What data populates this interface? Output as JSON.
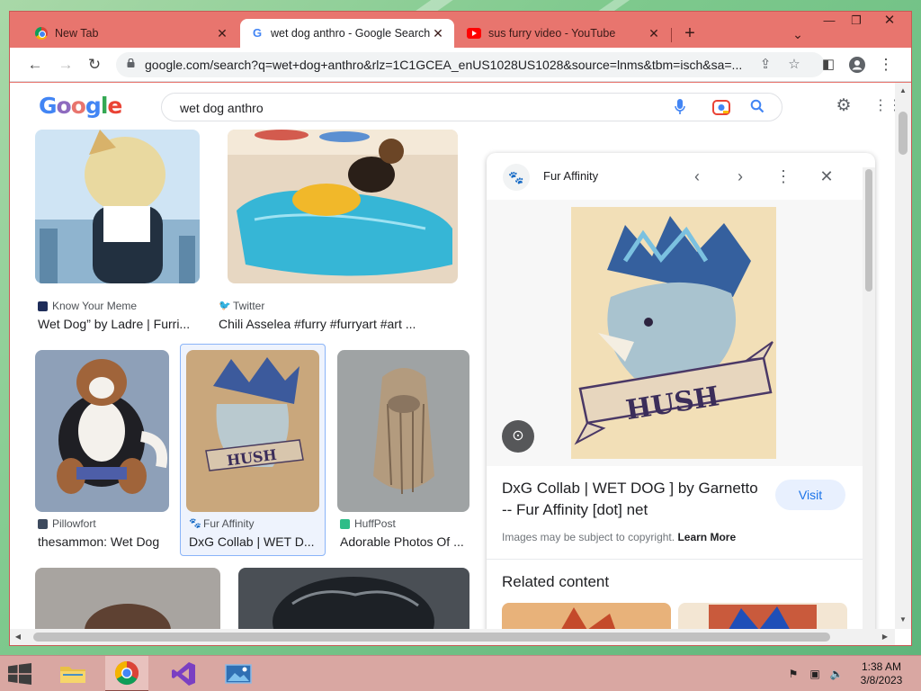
{
  "browser": {
    "tabs": [
      {
        "title": "New Tab",
        "favicon": "chrome-icon",
        "active": false
      },
      {
        "title": "wet dog anthro - Google Search",
        "favicon": "google-icon",
        "active": true
      },
      {
        "title": "sus furry video - YouTube",
        "favicon": "youtube-icon",
        "active": false
      }
    ],
    "url": "google.com/search?q=wet+dog+anthro&rlz=1C1GCEA_enUS1028US1028&source=lnms&tbm=isch&sa=..."
  },
  "google": {
    "logo_text": "Google",
    "query": "wet dog anthro"
  },
  "results": [
    {
      "source": "Know Your Meme",
      "title": "Wet Dog” by Ladre | Furri..."
    },
    {
      "source": "Twitter",
      "title": "Chili Asselea #furry #furryart #art ..."
    },
    {
      "source": "Pillowfort",
      "title": "thesammon: Wet Dog"
    },
    {
      "source": "Fur Affinity",
      "title": "DxG Collab | WET D..."
    },
    {
      "source": "HuffPost",
      "title": "Adorable Photos Of ..."
    }
  ],
  "panel": {
    "source": "Fur Affinity",
    "image_text": "HUSH",
    "title": "DxG Collab | WET DOG ] by Garnetto -- Fur Affinity [dot] net",
    "visit_label": "Visit",
    "copyright_text": "Images may be subject to copyright.",
    "learn_more": "Learn More",
    "related_heading": "Related content"
  },
  "taskbar": {
    "time": "1:38 AM",
    "date": "3/8/2023"
  },
  "colors": {
    "tabstrip": "#e8756e",
    "link_blue": "#1a73e8",
    "taskbar": "#d9a7a2"
  }
}
